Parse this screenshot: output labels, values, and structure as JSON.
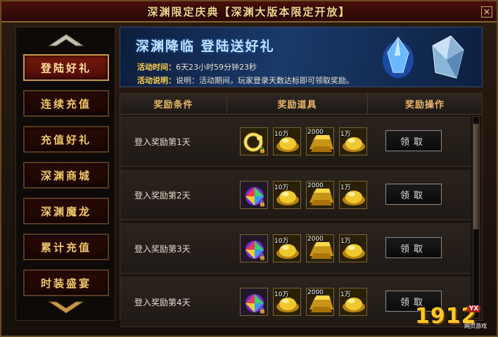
{
  "window": {
    "title": "深渊限定庆典【深渊大版本限定开放】",
    "close_label": "✕"
  },
  "sidebar": {
    "items": [
      {
        "label": "登陆好礼",
        "active": true
      },
      {
        "label": "连续充值",
        "active": false
      },
      {
        "label": "充值好礼",
        "active": false
      },
      {
        "label": "深渊商城",
        "active": false
      },
      {
        "label": "深渊魔龙",
        "active": false
      },
      {
        "label": "累计充值",
        "active": false
      },
      {
        "label": "时装盛宴",
        "active": false
      }
    ]
  },
  "banner": {
    "title": "深渊降临 登陆送好礼",
    "time_label": "活动时间：",
    "time_value": "6天23小时59分钟23秒",
    "desc_label": "活动说明：",
    "desc_value": "说明：活动期间，玩家登录天数达标即可领取奖励。"
  },
  "table": {
    "headers": [
      "奖励条件",
      "奖励道具",
      "奖励操作"
    ],
    "rows": [
      {
        "condition": "登入奖励第1天",
        "items": [
          {
            "icon": "gold-ring-icon",
            "label": "",
            "locked": true
          },
          {
            "icon": "gold-ingot-icon",
            "label": "10万",
            "locked": false
          },
          {
            "icon": "gold-bar-icon",
            "label": "2000",
            "locked": false
          },
          {
            "icon": "gold-ingot-icon",
            "label": "1万",
            "locked": false
          }
        ],
        "button": "领取"
      },
      {
        "condition": "登入奖励第2天",
        "items": [
          {
            "icon": "rainbow-gem-icon",
            "label": "",
            "locked": true
          },
          {
            "icon": "gold-ingot-icon",
            "label": "10万",
            "locked": false
          },
          {
            "icon": "gold-bar-icon",
            "label": "2000",
            "locked": false
          },
          {
            "icon": "gold-ingot-icon",
            "label": "1万",
            "locked": false
          }
        ],
        "button": "领取"
      },
      {
        "condition": "登入奖励第3天",
        "items": [
          {
            "icon": "rainbow-gem-icon",
            "label": "",
            "locked": true
          },
          {
            "icon": "gold-ingot-icon",
            "label": "10万",
            "locked": false
          },
          {
            "icon": "gold-bar-icon",
            "label": "2000",
            "locked": false
          },
          {
            "icon": "gold-ingot-icon",
            "label": "1万",
            "locked": false
          }
        ],
        "button": "领取"
      },
      {
        "condition": "登入奖励第4天",
        "items": [
          {
            "icon": "rainbow-gem-icon",
            "label": "",
            "locked": true
          },
          {
            "icon": "gold-ingot-icon",
            "label": "10万",
            "locked": false
          },
          {
            "icon": "gold-bar-icon",
            "label": "2000",
            "locked": false
          },
          {
            "icon": "gold-ingot-icon",
            "label": "1万",
            "locked": false
          }
        ],
        "button": "领取"
      }
    ]
  },
  "logo": {
    "number": "1912",
    "badge": "YX",
    "subtitle": "网页游戏"
  }
}
